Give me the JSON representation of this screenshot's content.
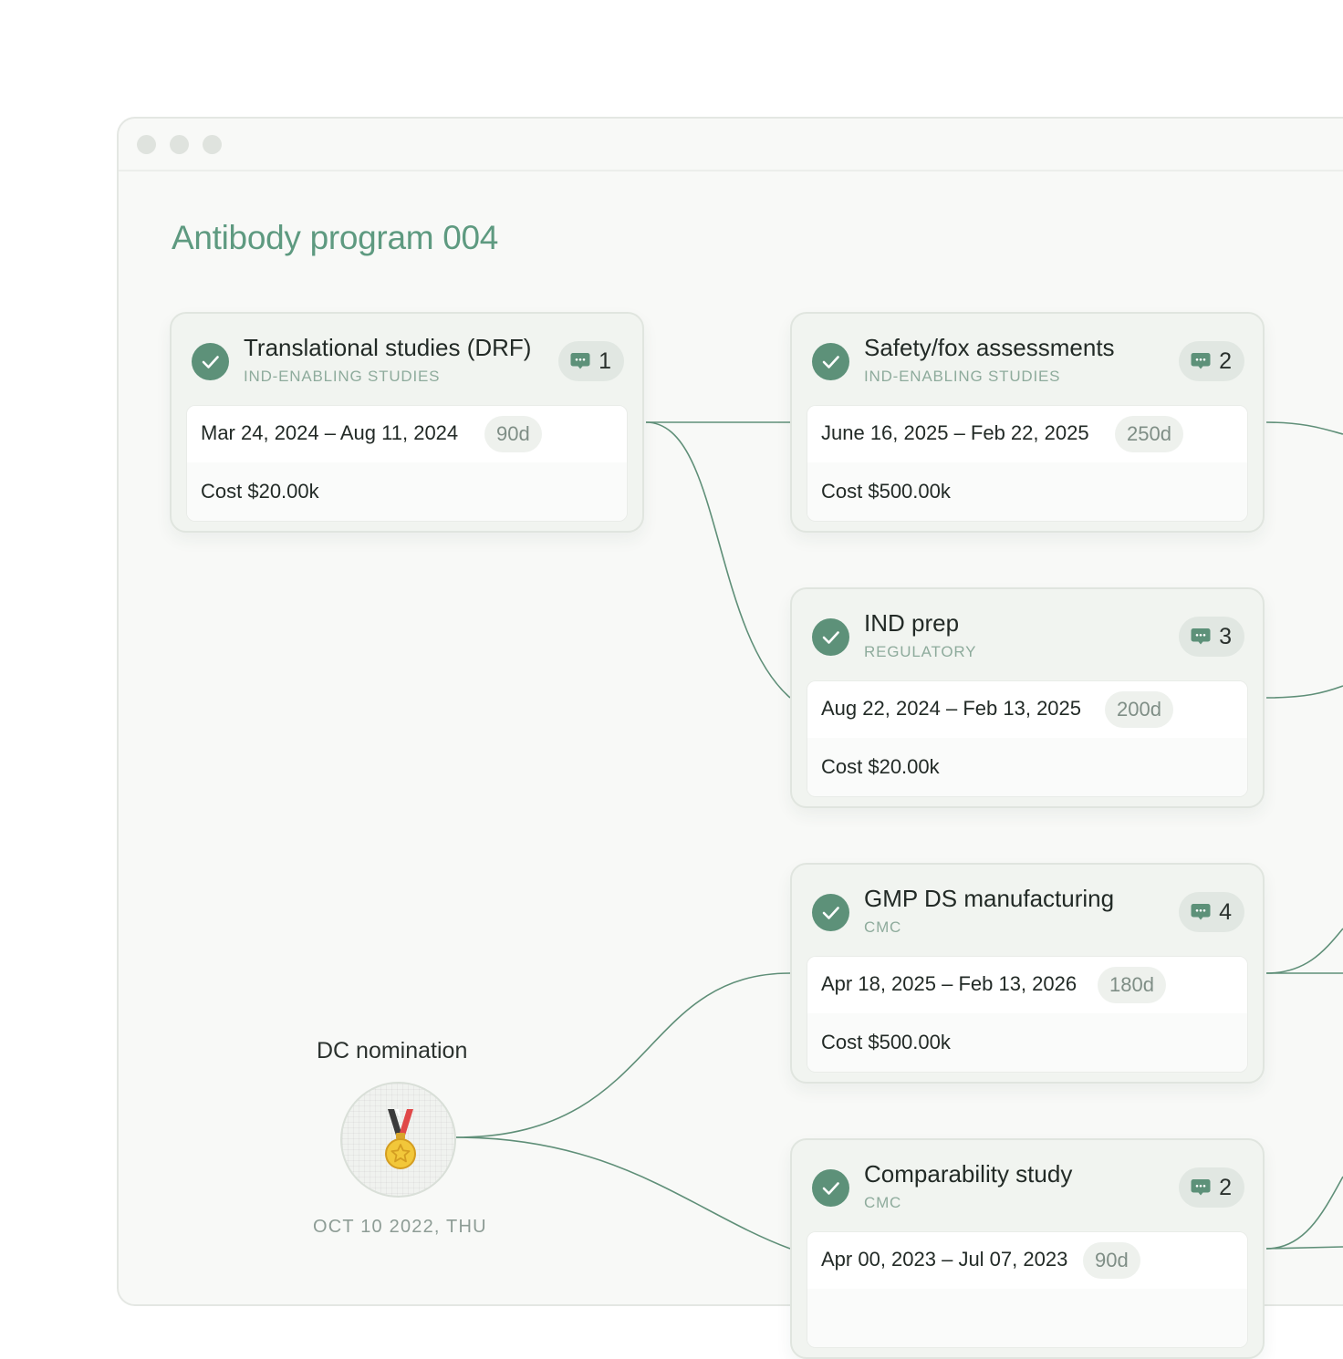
{
  "window": {
    "title": "Antibody program 004"
  },
  "colors": {
    "accent": "#5e9a80",
    "check": "#5d9179",
    "edge": "#5f8f78",
    "category": "#8eab9c"
  },
  "cards": [
    {
      "title": "Translational studies (DRF)",
      "category": "IND-ENABLING STUDIES",
      "comments": "1",
      "dates": "Mar 24, 2024 – Aug 11, 2024",
      "duration": "90d",
      "cost": "Cost $20.00k",
      "status_icon": "check-icon"
    },
    {
      "title": "Safety/fox assessments",
      "category": "IND-ENABLING STUDIES",
      "comments": "2",
      "dates": "June 16, 2025 – Feb 22, 2025",
      "duration": "250d",
      "cost": "Cost $500.00k",
      "status_icon": "check-icon"
    },
    {
      "title": "IND prep",
      "category": "REGULATORY",
      "comments": "3",
      "dates": "Aug 22, 2024 – Feb 13, 2025",
      "duration": "200d",
      "cost": "Cost $20.00k",
      "status_icon": "check-icon"
    },
    {
      "title": "GMP DS manufacturing",
      "category": "CMC",
      "comments": "4",
      "dates": "Apr 18, 2025 – Feb 13, 2026",
      "duration": "180d",
      "cost": "Cost $500.00k",
      "status_icon": "check-icon"
    },
    {
      "title": "Comparability study",
      "category": "CMC",
      "comments": "2",
      "dates": "Apr 00, 2023 – Jul 07, 2023",
      "duration": "90d",
      "cost": "",
      "status_icon": "check-icon"
    }
  ],
  "milestone": {
    "label": "DC nomination",
    "date": "OCT 10 2022, THU",
    "icon": "medal-icon"
  }
}
